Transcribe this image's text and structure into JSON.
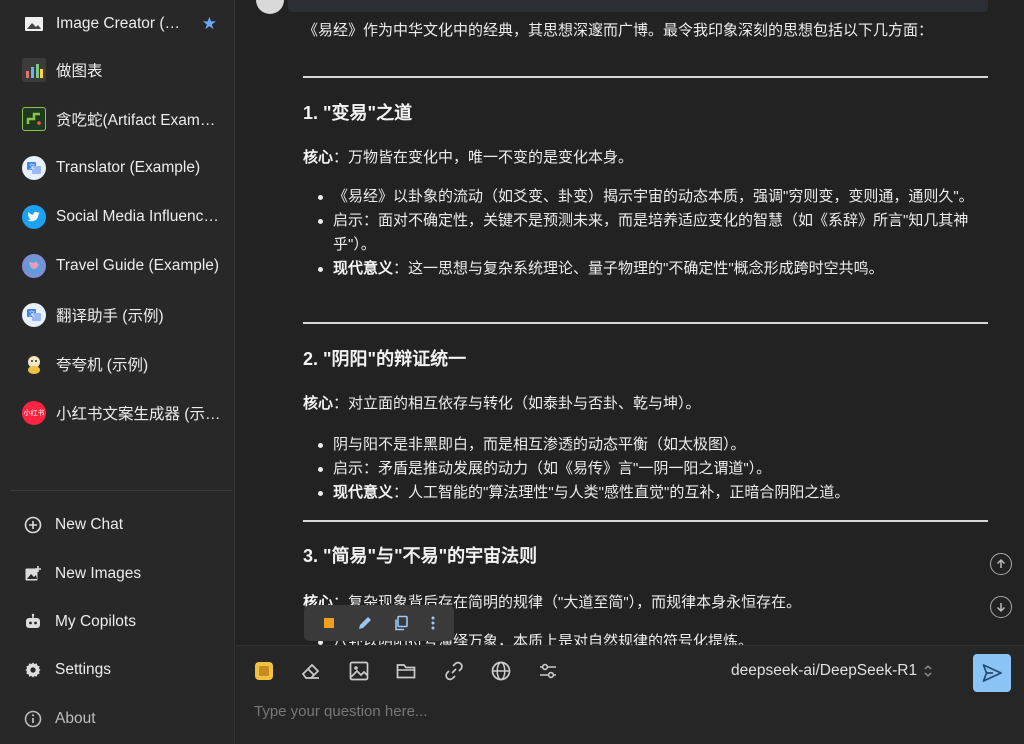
{
  "sidebar": {
    "copilots": [
      {
        "label": "Image Creator (…",
        "icon": "image-icon",
        "starred": true
      },
      {
        "label": "做图表",
        "icon": "chart-icon"
      },
      {
        "label": "贪吃蛇(Artifact Exam…",
        "icon": "snake-game-icon"
      },
      {
        "label": "Translator (Example)",
        "icon": "translate-icon"
      },
      {
        "label": "Social Media Influenc…",
        "icon": "twitter-icon"
      },
      {
        "label": "Travel Guide (Example)",
        "icon": "globe-icon"
      },
      {
        "label": "翻译助手 (示例)",
        "icon": "translate-icon"
      },
      {
        "label": "夸夸机 (示例)",
        "icon": "character-icon"
      },
      {
        "label": "小红书文案生成器 (示…",
        "icon": "xiaohongshu-icon",
        "badge": "小红书"
      }
    ],
    "nav": [
      {
        "label": "New Chat",
        "icon": "plus-circle-icon"
      },
      {
        "label": "New Images",
        "icon": "new-image-icon"
      },
      {
        "label": "My Copilots",
        "icon": "robot-icon"
      },
      {
        "label": "Settings",
        "icon": "gear-icon"
      },
      {
        "label": "About",
        "icon": "info-icon"
      }
    ]
  },
  "message": {
    "intro": "《易经》作为中华文化中的经典，其思想深邃而广博。最令我印象深刻的思想包括以下几方面：",
    "sections": [
      {
        "title": "1. \"变易\"之道",
        "core_label": "核心",
        "core_text": "：万物皆在变化中，唯一不变的是变化本身。",
        "bullets": [
          {
            "bold": "",
            "text": "《易经》以卦象的流动（如爻变、卦变）揭示宇宙的动态本质，强调\"穷则变，变则通，通则久\"。"
          },
          {
            "bold": "",
            "text": "启示：面对不确定性，关键不是预测未来，而是培养适应变化的智慧（如《系辞》所言\"知几其神乎\"）。"
          },
          {
            "bold": "现代意义",
            "text": "：这一思想与复杂系统理论、量子物理的\"不确定性\"概念形成跨时空共鸣。"
          }
        ]
      },
      {
        "title": "2. \"阴阳\"的辩证统一",
        "core_label": "核心",
        "core_text": "：对立面的相互依存与转化（如泰卦与否卦、乾与坤）。",
        "bullets": [
          {
            "bold": "",
            "text": "阴与阳不是非黑即白，而是相互渗透的动态平衡（如太极图）。"
          },
          {
            "bold": "",
            "text": "启示：矛盾是推动发展的动力（如《易传》言\"一阴一阳之谓道\"）。"
          },
          {
            "bold": "现代意义",
            "text": "：人工智能的\"算法理性\"与人类\"感性直觉\"的互补，正暗合阴阳之道。"
          }
        ]
      },
      {
        "title": "3. \"简易\"与\"不易\"的宇宙法则",
        "core_label": "核心",
        "core_text": "：复杂现象背后存在简明的规律（\"大道至简\"），而规律本身永恒存在。",
        "partial": "八卦以阴阳符号演绎万象，本质上是对自然规律的符号化提炼。"
      }
    ]
  },
  "input": {
    "placeholder": "Type your question here...",
    "value": "",
    "model": "deepseek-ai/DeepSeek-R1"
  },
  "colors": {
    "background": "#222222",
    "sidebar": "#282828",
    "send_button": "#8cc4f5",
    "star": "#6ea8fe"
  }
}
